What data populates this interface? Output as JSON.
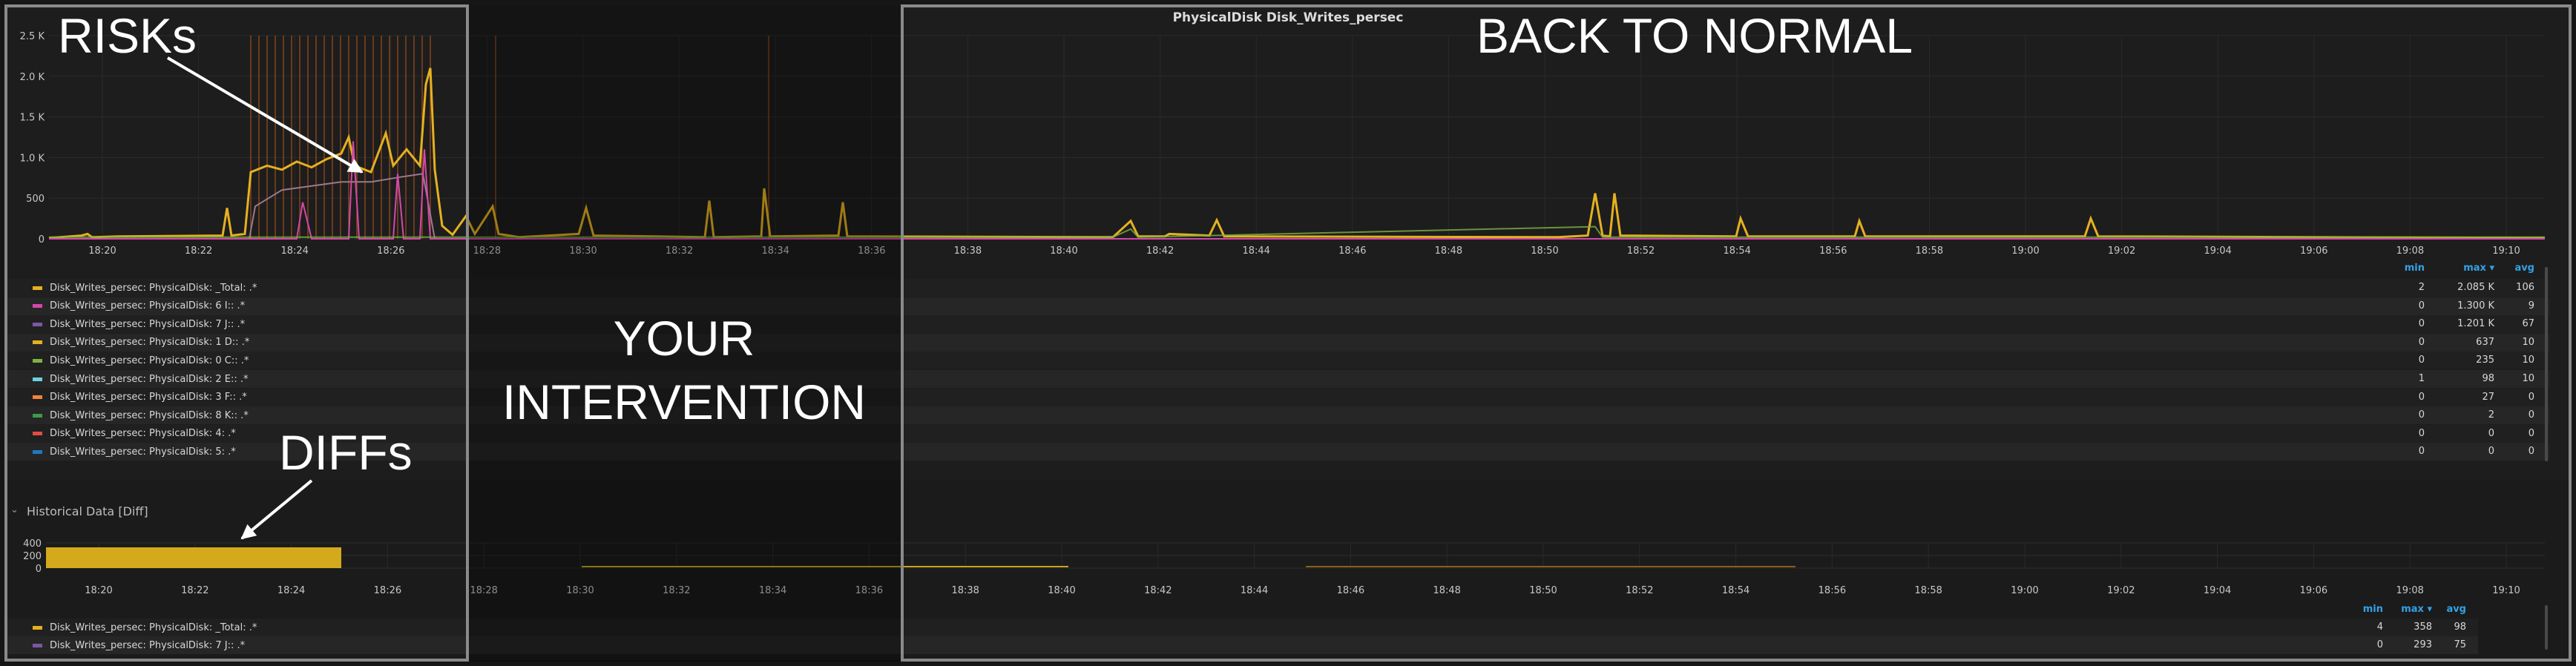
{
  "panel": {
    "title": "PhysicalDisk Disk_Writes_persec",
    "y_ticks": [
      "2.5 K",
      "2.0 K",
      "1.5 K",
      "1.0 K",
      "500",
      "0"
    ],
    "x_ticks": [
      "18:20",
      "18:22",
      "18:24",
      "18:26",
      "18:28",
      "18:30",
      "18:32",
      "18:34",
      "18:36",
      "18:38",
      "18:40",
      "18:42",
      "18:44",
      "18:46",
      "18:48",
      "18:50",
      "18:52",
      "18:54",
      "18:56",
      "18:58",
      "19:00",
      "19:02",
      "19:04",
      "19:06",
      "19:08",
      "19:10"
    ]
  },
  "legend": {
    "columns": [
      "min",
      "max",
      "avg"
    ],
    "max_sort_indicator": "▾",
    "series": [
      {
        "label": "Disk_Writes_persec: PhysicalDisk: _Total: .*",
        "color": "#e5b120",
        "min": "2",
        "max": "2.085 K",
        "avg": "106"
      },
      {
        "label": "Disk_Writes_persec: PhysicalDisk: 6 I:: .*",
        "color": "#d249a8",
        "min": "0",
        "max": "1.300 K",
        "avg": "9"
      },
      {
        "label": "Disk_Writes_persec: PhysicalDisk: 7 J:: .*",
        "color": "#7b58a6",
        "min": "0",
        "max": "1.201 K",
        "avg": "67"
      },
      {
        "label": "Disk_Writes_persec: PhysicalDisk: 1 D:: .*",
        "color": "#e5b120",
        "min": "0",
        "max": "637",
        "avg": "10"
      },
      {
        "label": "Disk_Writes_persec: PhysicalDisk: 0 C:: .*",
        "color": "#7cb342",
        "min": "0",
        "max": "235",
        "avg": "10"
      },
      {
        "label": "Disk_Writes_persec: PhysicalDisk: 2 E:: .*",
        "color": "#6ed0e0",
        "min": "1",
        "max": "98",
        "avg": "10"
      },
      {
        "label": "Disk_Writes_persec: PhysicalDisk: 3 F:: .*",
        "color": "#ef843c",
        "min": "0",
        "max": "27",
        "avg": "0"
      },
      {
        "label": "Disk_Writes_persec: PhysicalDisk: 8 K:: .*",
        "color": "#3f9b46",
        "min": "0",
        "max": "2",
        "avg": "0"
      },
      {
        "label": "Disk_Writes_persec: PhysicalDisk: 4: .*",
        "color": "#e24d42",
        "min": "0",
        "max": "0",
        "avg": "0"
      },
      {
        "label": "Disk_Writes_persec: PhysicalDisk: 5: .*",
        "color": "#1f78c1",
        "min": "0",
        "max": "0",
        "avg": "0"
      }
    ]
  },
  "history": {
    "title": "Historical Data [Diff]",
    "y_ticks": [
      "400",
      "200",
      "0"
    ],
    "x_ticks": [
      "18:20",
      "18:22",
      "18:24",
      "18:26",
      "18:28",
      "18:30",
      "18:32",
      "18:34",
      "18:36",
      "18:38",
      "18:40",
      "18:42",
      "18:44",
      "18:46",
      "18:48",
      "18:50",
      "18:52",
      "18:54",
      "18:56",
      "18:58",
      "19:00",
      "19:02",
      "19:04",
      "19:06",
      "19:08",
      "19:10"
    ],
    "series": [
      {
        "label": "Disk_Writes_persec: PhysicalDisk: _Total: .*",
        "color": "#e5b120",
        "min": "4",
        "max": "358",
        "avg": "98"
      },
      {
        "label": "Disk_Writes_persec: PhysicalDisk: 7 J:: .*",
        "color": "#7b58a6",
        "min": "0",
        "max": "293",
        "avg": "75"
      }
    ]
  },
  "annotations": {
    "risks": "RISKs",
    "back_to_normal": "BACK TO NORMAL",
    "intervention_line1": "YOUR",
    "intervention_line2": "INTERVENTION",
    "diffs": "DIFFs"
  }
}
